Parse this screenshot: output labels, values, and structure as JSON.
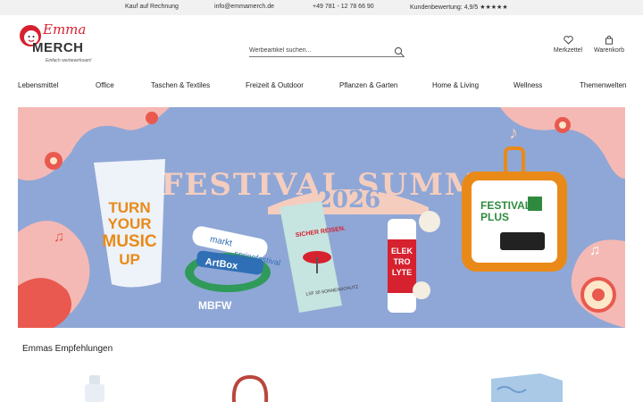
{
  "topbar": {
    "invoice": "Kauf auf Rechnung",
    "email": "info@emmamerch.de",
    "phone": "+49 781 - 12 78 66 90",
    "rating": "Kundenbewertung: 4,9/5 ★★★★★"
  },
  "logo": {
    "emma": "Emma",
    "merch": "MERCH",
    "tagline": "Einfach werbewirksam!"
  },
  "search": {
    "placeholder": "Werbeartikel suchen..."
  },
  "header": {
    "wishlist": "Merkzettel",
    "cart": "Warenkorb"
  },
  "nav": [
    "Lebensmittel",
    "Office",
    "Taschen & Textiles",
    "Freizeit & Outdoor",
    "Pflanzen & Garten",
    "Home & Living",
    "Wellness",
    "Themenwelten"
  ],
  "banner": {
    "headline": "FESTIVAL SUMMER",
    "year": "2026",
    "cup_text": [
      "TURN",
      "YOUR",
      "MUSIC",
      "UP"
    ],
    "band_texts": [
      "markt",
      "springfestival",
      "ArtBox",
      "MBFW"
    ],
    "sachet_title": "SICHER REISEN.",
    "sachet_sub": "LSF 30 SONNENSCHUTZ",
    "tube_text": [
      "ELEK",
      "TRO",
      "LYTE"
    ],
    "kit_text": [
      "FESTIVAL",
      "PLUS"
    ]
  },
  "recommendations": {
    "title": "Emmas Empfehlungen"
  },
  "colors": {
    "brand_red": "#d6212f",
    "banner_bg": "#8fa7d6",
    "topbar_bg": "#f1f1f1"
  }
}
